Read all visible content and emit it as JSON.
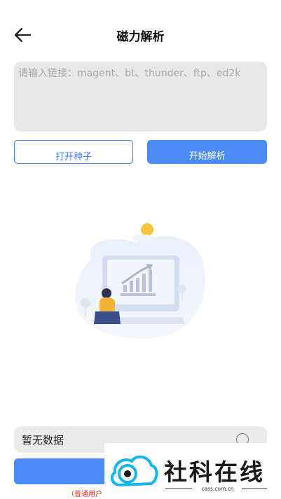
{
  "header": {
    "title": "磁力解析",
    "back_icon": "arrow-left-icon"
  },
  "input": {
    "placeholder": "请输入链接：magent、bt、thunder、ftp、ed2k",
    "value": ""
  },
  "buttons": {
    "open_seed": "打开种子",
    "start_parse": "开始解析"
  },
  "empty_state": {
    "illustration": "empty-data-illustration"
  },
  "result_bar": {
    "text": "暂无数据",
    "radio_icon": "radio-unchecked-icon"
  },
  "footer": {
    "note": "（普通用户"
  },
  "watermark": {
    "text": "社科在线",
    "sub": "cass.com.cn"
  },
  "colors": {
    "accent": "#4a8bf6",
    "input_bg": "#e8e8e8",
    "note": "#d9302b"
  }
}
